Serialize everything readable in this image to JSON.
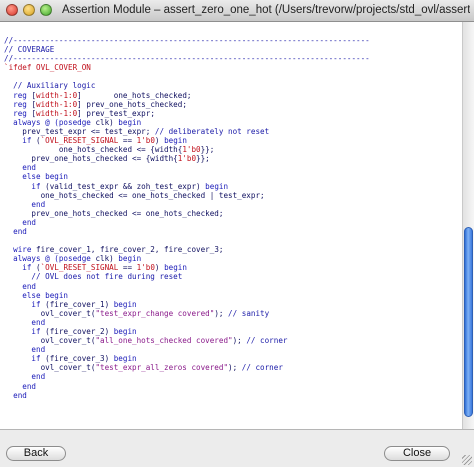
{
  "window": {
    "title": "Assertion Module – assert_zero_one_hot (/Users/trevorw/projects/std_ovl/assert_zero_one_hot.vlib)"
  },
  "buttons": {
    "back_label": "Back",
    "close_label": "Close"
  },
  "colors": {
    "comment": "#1a1aa8",
    "keyword": "#1a1ab8",
    "macro": "#c0101c",
    "string": "#8a1a8a",
    "scroll_thumb": "#3a78dc"
  },
  "code_lines": [
    [
      [
        "comment",
        "//------------------------------------------------------------------------------"
      ]
    ],
    [
      [
        "comment",
        "// COVERAGE"
      ]
    ],
    [
      [
        "comment",
        "//------------------------------------------------------------------------------"
      ]
    ],
    [
      [
        "macro",
        "`ifdef OVL_COVER_ON"
      ]
    ],
    [
      [
        "plain",
        ""
      ]
    ],
    [
      [
        "comment",
        "  // Auxiliary logic"
      ]
    ],
    [
      [
        "kw",
        "  reg "
      ],
      [
        "plain",
        "["
      ],
      [
        "macro",
        "width-1:0"
      ],
      [
        "plain",
        "]       one_hots_checked;"
      ]
    ],
    [
      [
        "kw",
        "  reg "
      ],
      [
        "plain",
        "["
      ],
      [
        "macro",
        "width-1:0"
      ],
      [
        "plain",
        "] prev_one_hots_checked;"
      ]
    ],
    [
      [
        "kw",
        "  reg "
      ],
      [
        "plain",
        "["
      ],
      [
        "macro",
        "width-1:0"
      ],
      [
        "plain",
        "] prev_test_expr;"
      ]
    ],
    [
      [
        "kw",
        "  always @ (posedge "
      ],
      [
        "plain",
        "clk) "
      ],
      [
        "kw",
        "begin"
      ]
    ],
    [
      [
        "plain",
        "    prev_test_expr <= test_expr; "
      ],
      [
        "comment",
        "// deliberately not reset"
      ]
    ],
    [
      [
        "kw",
        "    if "
      ],
      [
        "plain",
        "("
      ],
      [
        "macro",
        "`OVL_RESET_SIGNAL"
      ],
      [
        "plain",
        " == "
      ],
      [
        "num",
        "1'b0"
      ],
      [
        "plain",
        ") "
      ],
      [
        "kw",
        "begin"
      ]
    ],
    [
      [
        "plain",
        "            one_hots_checked <= {width{"
      ],
      [
        "num",
        "1'b0"
      ],
      [
        "plain",
        "}};"
      ]
    ],
    [
      [
        "plain",
        "      prev_one_hots_checked <= {width{"
      ],
      [
        "num",
        "1'b0"
      ],
      [
        "plain",
        "}};"
      ]
    ],
    [
      [
        "kw",
        "    end"
      ]
    ],
    [
      [
        "kw",
        "    else begin"
      ]
    ],
    [
      [
        "kw",
        "      if "
      ],
      [
        "plain",
        "(valid_test_expr && zoh_test_expr) "
      ],
      [
        "kw",
        "begin"
      ]
    ],
    [
      [
        "plain",
        "        one_hots_checked <= one_hots_checked | test_expr;"
      ]
    ],
    [
      [
        "kw",
        "      end"
      ]
    ],
    [
      [
        "plain",
        "      prev_one_hots_checked <= one_hots_checked;"
      ]
    ],
    [
      [
        "kw",
        "    end"
      ]
    ],
    [
      [
        "kw",
        "  end"
      ]
    ],
    [
      [
        "plain",
        ""
      ]
    ],
    [
      [
        "kw",
        "  wire "
      ],
      [
        "plain",
        "fire_cover_1, fire_cover_2, fire_cover_3;"
      ]
    ],
    [
      [
        "kw",
        "  always @ (posedge "
      ],
      [
        "plain",
        "clk) "
      ],
      [
        "kw",
        "begin"
      ]
    ],
    [
      [
        "kw",
        "    if "
      ],
      [
        "plain",
        "("
      ],
      [
        "macro",
        "`OVL_RESET_SIGNAL"
      ],
      [
        "plain",
        " == "
      ],
      [
        "num",
        "1'b0"
      ],
      [
        "plain",
        ") "
      ],
      [
        "kw",
        "begin"
      ]
    ],
    [
      [
        "comment",
        "      // OVL does not fire during reset"
      ]
    ],
    [
      [
        "kw",
        "    end"
      ]
    ],
    [
      [
        "kw",
        "    else begin"
      ]
    ],
    [
      [
        "kw",
        "      if "
      ],
      [
        "plain",
        "(fire_cover_1) "
      ],
      [
        "kw",
        "begin"
      ]
    ],
    [
      [
        "plain",
        "        ovl_cover_t("
      ],
      [
        "str",
        "\"test_expr_change covered\""
      ],
      [
        "plain",
        "); "
      ],
      [
        "comment",
        "// sanity"
      ]
    ],
    [
      [
        "kw",
        "      end"
      ]
    ],
    [
      [
        "kw",
        "      if "
      ],
      [
        "plain",
        "(fire_cover_2) "
      ],
      [
        "kw",
        "begin"
      ]
    ],
    [
      [
        "plain",
        "        ovl_cover_t("
      ],
      [
        "str",
        "\"all_one_hots_checked covered\""
      ],
      [
        "plain",
        "); "
      ],
      [
        "comment",
        "// corner"
      ]
    ],
    [
      [
        "kw",
        "      end"
      ]
    ],
    [
      [
        "kw",
        "      if "
      ],
      [
        "plain",
        "(fire_cover_3) "
      ],
      [
        "kw",
        "begin"
      ]
    ],
    [
      [
        "plain",
        "        ovl_cover_t("
      ],
      [
        "str",
        "\"test_expr_all_zeros covered\""
      ],
      [
        "plain",
        "); "
      ],
      [
        "comment",
        "// corner"
      ]
    ],
    [
      [
        "kw",
        "      end"
      ]
    ],
    [
      [
        "kw",
        "    end"
      ]
    ],
    [
      [
        "kw",
        "  end"
      ]
    ]
  ]
}
